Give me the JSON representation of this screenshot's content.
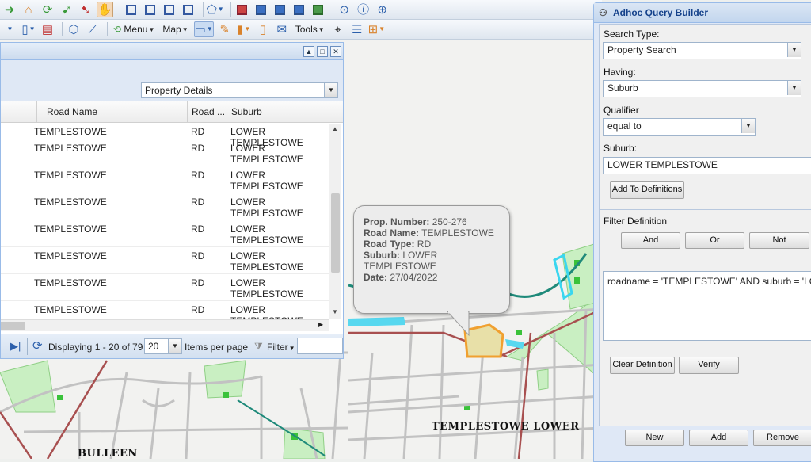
{
  "toolbar": {
    "menu_label": "Menu",
    "map_label": "Map",
    "tools_label": "Tools"
  },
  "grid": {
    "view_select": "Property Details",
    "columns": [
      "Road Name",
      "Road ...",
      "Suburb"
    ],
    "rows": [
      {
        "road_name": "TEMPLESTOWE",
        "road_type": "RD",
        "suburb": "LOWER TEMPLESTOWE"
      },
      {
        "road_name": "TEMPLESTOWE",
        "road_type": "RD",
        "suburb": "LOWER TEMPLESTOWE"
      },
      {
        "road_name": "TEMPLESTOWE",
        "road_type": "RD",
        "suburb": "LOWER TEMPLESTOWE"
      },
      {
        "road_name": "TEMPLESTOWE",
        "road_type": "RD",
        "suburb": "LOWER TEMPLESTOWE"
      },
      {
        "road_name": "TEMPLESTOWE",
        "road_type": "RD",
        "suburb": "LOWER TEMPLESTOWE"
      },
      {
        "road_name": "TEMPLESTOWE",
        "road_type": "RD",
        "suburb": "LOWER TEMPLESTOWE"
      },
      {
        "road_name": "TEMPLESTOWE",
        "road_type": "RD",
        "suburb": "LOWER TEMPLESTOWE"
      },
      {
        "road_name": "TEMPLESTOWE",
        "road_type": "RD",
        "suburb": "LOWER TEMPLESTOWE"
      }
    ],
    "pager": {
      "displaying": "Displaying 1 - 20 of 79",
      "page_size": "20",
      "items_per_page": "Items per page",
      "filter_label": "Filter"
    }
  },
  "popup": {
    "prop_number_label": "Prop. Number:",
    "prop_number": "250-276",
    "road_name_label": "Road Name:",
    "road_name": "TEMPLESTOWE",
    "road_type_label": "Road Type:",
    "road_type": "RD",
    "suburb_label": "Suburb:",
    "suburb": "LOWER TEMPLESTOWE",
    "date_label": "Date:",
    "date": "27/04/2022"
  },
  "map": {
    "labels": {
      "templestowe_lower": "TEMPLESTOWE LOWER",
      "bulleen": "BULLEEN"
    },
    "colors": {
      "park": "#c9efc2",
      "road_main": "#a85050",
      "river": "#1f8a7a",
      "selected": "#f0a030"
    }
  },
  "adhoc": {
    "title": "Adhoc Query Builder",
    "search_type_label": "Search Type:",
    "search_type_value": "Property Search",
    "having_label": "Having:",
    "having_value": "Suburb",
    "qualifier_label": "Qualifier",
    "qualifier_value": "equal to",
    "suburb_label": "Suburb:",
    "suburb_value": "LOWER TEMPLESTOWE",
    "add_to_definitions": "Add To Definitions",
    "filter_definition_label": "Filter Definition",
    "and_label": "And",
    "or_label": "Or",
    "not_label": "Not",
    "definition_text": "roadname = 'TEMPLESTOWE' AND suburb = 'LOWER TEMPLESTOWE'",
    "clear_definition": "Clear Definition",
    "verify": "Verify",
    "new": "New",
    "add": "Add",
    "remove": "Remove"
  }
}
